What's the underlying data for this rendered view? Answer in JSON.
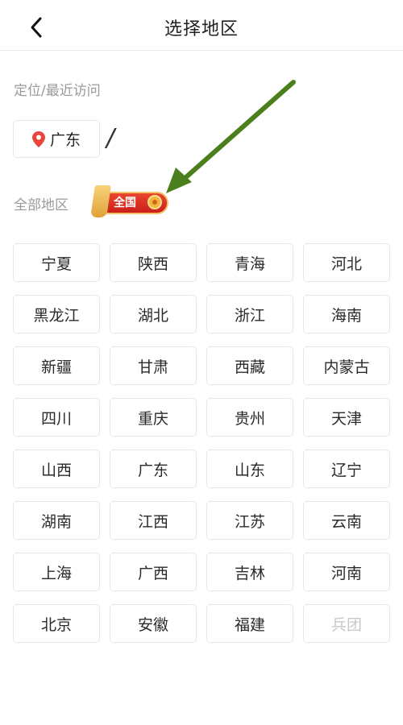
{
  "header": {
    "title": "选择地区"
  },
  "recent": {
    "label": "定位/最近访问",
    "location": "广东",
    "cursor_mark": "/"
  },
  "all_regions": {
    "label": "全部地区",
    "national_badge": "全国",
    "regions": [
      {
        "name": "宁夏",
        "enabled": true
      },
      {
        "name": "陕西",
        "enabled": true
      },
      {
        "name": "青海",
        "enabled": true
      },
      {
        "name": "河北",
        "enabled": true
      },
      {
        "name": "黑龙江",
        "enabled": true
      },
      {
        "name": "湖北",
        "enabled": true
      },
      {
        "name": "浙江",
        "enabled": true
      },
      {
        "name": "海南",
        "enabled": true
      },
      {
        "name": "新疆",
        "enabled": true
      },
      {
        "name": "甘肃",
        "enabled": true
      },
      {
        "name": "西藏",
        "enabled": true
      },
      {
        "name": "内蒙古",
        "enabled": true
      },
      {
        "name": "四川",
        "enabled": true
      },
      {
        "name": "重庆",
        "enabled": true
      },
      {
        "name": "贵州",
        "enabled": true
      },
      {
        "name": "天津",
        "enabled": true
      },
      {
        "name": "山西",
        "enabled": true
      },
      {
        "name": "广东",
        "enabled": true
      },
      {
        "name": "山东",
        "enabled": true
      },
      {
        "name": "辽宁",
        "enabled": true
      },
      {
        "name": "湖南",
        "enabled": true
      },
      {
        "name": "江西",
        "enabled": true
      },
      {
        "name": "江苏",
        "enabled": true
      },
      {
        "name": "云南",
        "enabled": true
      },
      {
        "name": "上海",
        "enabled": true
      },
      {
        "name": "广西",
        "enabled": true
      },
      {
        "name": "吉林",
        "enabled": true
      },
      {
        "name": "河南",
        "enabled": true
      },
      {
        "name": "北京",
        "enabled": true
      },
      {
        "name": "安徽",
        "enabled": true
      },
      {
        "name": "福建",
        "enabled": true
      },
      {
        "name": "兵团",
        "enabled": false
      }
    ]
  },
  "icons": {
    "back": "chevron-left-icon",
    "location": "map-pin-icon",
    "badge_emblem": "emblem-icon"
  },
  "colors": {
    "pin": "#e8453c",
    "badge_red": "#d42a1f",
    "badge_gold": "#f3c266",
    "arrow_green": "#4a7f1c",
    "disabled_text": "#c8c8c8"
  }
}
